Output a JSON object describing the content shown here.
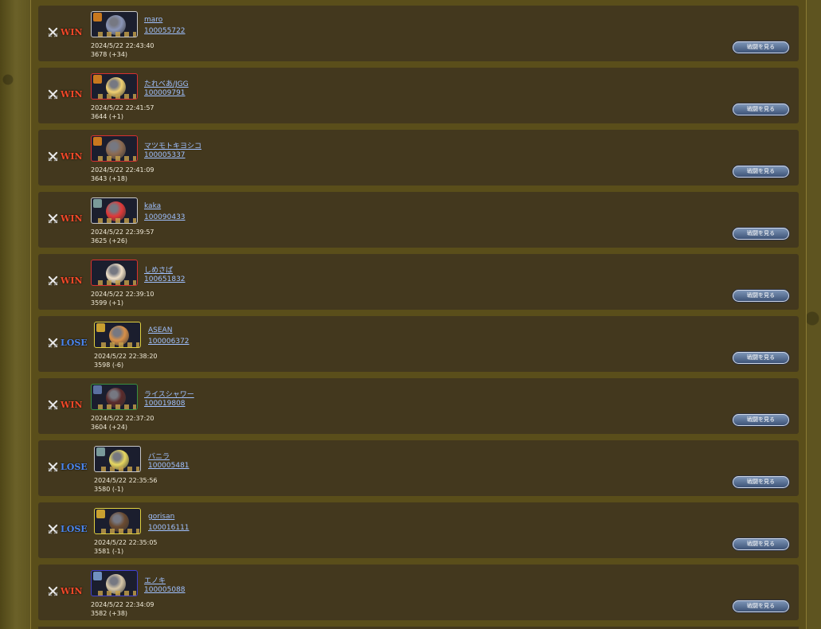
{
  "battles": [
    {
      "result": "WIN",
      "name": "maro",
      "id": "100055722",
      "time": "2024/5/22 22:43:40",
      "rating": "3678 (+34)",
      "frame": "",
      "face": "#8a95b8",
      "badge": "#c8781e"
    },
    {
      "result": "WIN",
      "name": "たれべあ/JGG",
      "id": "100009791",
      "time": "2024/5/22 22:41:57",
      "rating": "3644 (+1)",
      "frame": "red",
      "face": "#f0d070",
      "badge": "#c8781e"
    },
    {
      "result": "WIN",
      "name": "マツモトキヨシコ",
      "id": "100005337",
      "time": "2024/5/22 22:41:09",
      "rating": "3643 (+18)",
      "frame": "red",
      "face": "#8c6a50",
      "badge": "#c8781e"
    },
    {
      "result": "WIN",
      "name": "kaka",
      "id": "100090433",
      "time": "2024/5/22 22:39:57",
      "rating": "3625 (+26)",
      "frame": "",
      "face": "#e03838",
      "badge": "#7a9a9a"
    },
    {
      "result": "WIN",
      "name": "しめさば",
      "id": "100651832",
      "time": "2024/5/22 22:39:10",
      "rating": "3599 (+1)",
      "frame": "red",
      "face": "#f0e0c8",
      "badge": ""
    },
    {
      "result": "LOSE",
      "name": "ASEAN",
      "id": "100006372",
      "time": "2024/5/22 22:38:20",
      "rating": "3598 (-6)",
      "frame": "yel",
      "face": "#d89048",
      "badge": "#c8a030"
    },
    {
      "result": "WIN",
      "name": "ライスシャワー",
      "id": "100019808",
      "time": "2024/5/22 22:37:20",
      "rating": "3604 (+24)",
      "frame": "grn",
      "face": "#5a2a2a",
      "badge": "#5a70a0"
    },
    {
      "result": "LOSE",
      "name": "バニラ",
      "id": "100005481",
      "time": "2024/5/22 22:35:56",
      "rating": "3580 (-1)",
      "frame": "",
      "face": "#e8d860",
      "badge": "#7a9a9a"
    },
    {
      "result": "LOSE",
      "name": "gorisan",
      "id": "100016111",
      "time": "2024/5/22 22:35:05",
      "rating": "3581 (-1)",
      "frame": "yel",
      "face": "#6a4a30",
      "badge": "#c8a030"
    },
    {
      "result": "WIN",
      "name": "エノキ",
      "id": "100005088",
      "time": "2024/5/22 22:34:09",
      "rating": "3582 (+38)",
      "frame": "blu",
      "face": "#d8c8a8",
      "badge": "#7090c0"
    }
  ],
  "button_label": "戦闘を見る",
  "colors": {
    "win": "#f04828",
    "lose": "#4a86f0",
    "row": "#43381e",
    "link": "#9fc0ff"
  }
}
